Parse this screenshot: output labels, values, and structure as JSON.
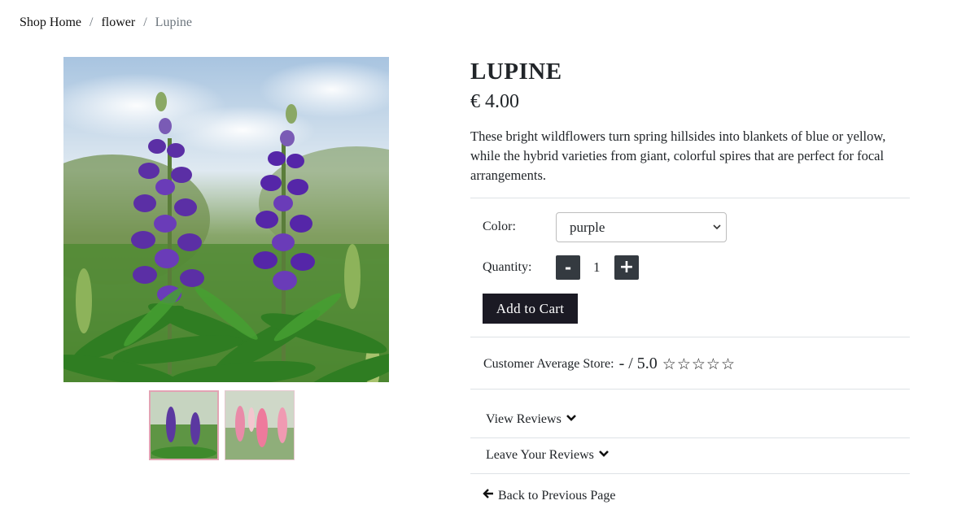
{
  "breadcrumb": {
    "home": "Shop Home",
    "category": "flower",
    "current": "Lupine",
    "separator": "/"
  },
  "product": {
    "title": "LUPINE",
    "price": "€ 4.00",
    "description": "These bright wildflowers turn spring hillsides into blankets of blue or yellow, while the hybrid varieties from giant, colorful spires that are perfect for focal arrangements."
  },
  "options": {
    "color_label": "Color:",
    "color_value": "purple",
    "quantity_label": "Quantity:",
    "quantity_value": "1",
    "minus_label": "-",
    "plus_label": "+",
    "add_to_cart": "Add to Cart"
  },
  "rating": {
    "label": "Customer Average Store:",
    "value": "- / 5.0",
    "stars_filled": 0,
    "stars_total": 5
  },
  "reviews": {
    "view": "View Reviews",
    "leave": "Leave Your Reviews"
  },
  "back_link": "Back to Previous Page",
  "colors": {
    "button_dark": "#343a40",
    "cart_button": "#1b1a24",
    "thumb_active_border": "#e2a3b3"
  },
  "icons": {
    "chevron": "chevron-down-icon",
    "back": "arrow-left-icon",
    "star": "star-outline-icon"
  }
}
